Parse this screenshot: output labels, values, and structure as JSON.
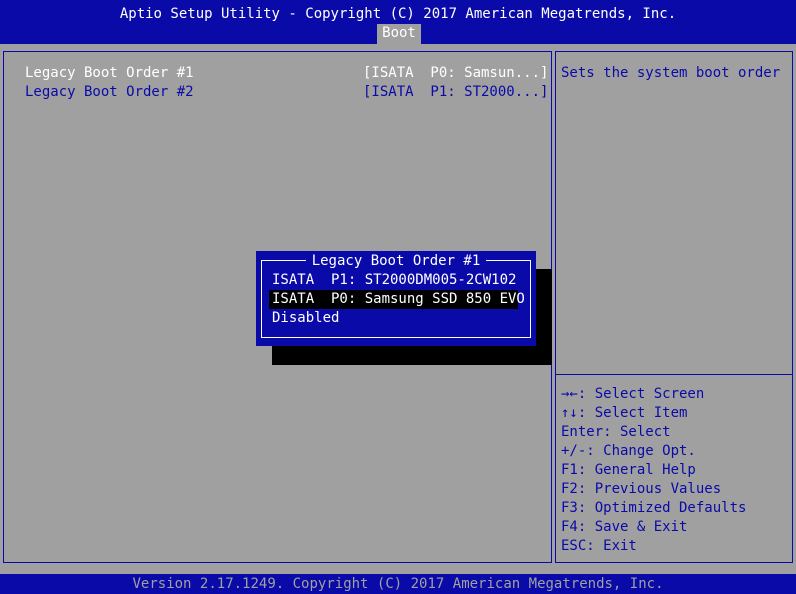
{
  "header": {
    "title": "Aptio Setup Utility - Copyright (C) 2017 American Megatrends, Inc.",
    "active_tab": "Boot"
  },
  "main": {
    "items": [
      {
        "label": "Legacy Boot Order #1",
        "value": "[ISATA  P0: Samsun...]"
      },
      {
        "label": "Legacy Boot Order #2",
        "value": "[ISATA  P1: ST2000...]"
      }
    ]
  },
  "help": {
    "description": "Sets the system boot order",
    "keys": [
      "→←: Select Screen",
      "↑↓: Select Item",
      "Enter: Select",
      "+/-: Change Opt.",
      "F1: General Help",
      "F2: Previous Values",
      "F3: Optimized Defaults",
      "F4: Save & Exit",
      "ESC: Exit"
    ]
  },
  "popup": {
    "title": "Legacy Boot Order #1",
    "options": [
      "ISATA  P1: ST2000DM005-2CW102",
      "ISATA  P0: Samsung SSD 850 EVO",
      "Disabled"
    ],
    "selected_index": 1
  },
  "footer": {
    "text": "Version 2.17.1249. Copyright (C) 2017 American Megatrends, Inc."
  },
  "colors": {
    "bios_blue": "#0a0aa8",
    "bios_gray": "#a0a0a0",
    "highlight": "#000000",
    "text_white": "#ffffff"
  }
}
